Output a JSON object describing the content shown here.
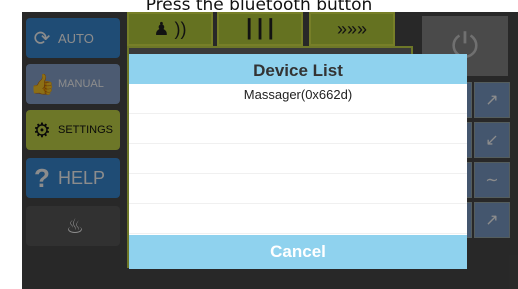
{
  "caption": "Press the bluetooth button",
  "menu": {
    "auto": "AUTO",
    "manual": "MANUAL",
    "settings": "SETTINGS",
    "help": "HELP"
  },
  "dialog": {
    "title": "Device List",
    "devices": [
      "Massager(0x662d)",
      "",
      "",
      "",
      ""
    ],
    "cancel": "Cancel"
  },
  "colors": {
    "dialog_header": "#8fd2ee",
    "menu_blue": "#3a8bd6",
    "menu_green": "#c7d94a"
  },
  "icons": {
    "auto": "refresh-icon",
    "manual": "thumbs-up-icon",
    "settings": "gear-icon",
    "help": "question-icon",
    "power": "power-icon"
  }
}
